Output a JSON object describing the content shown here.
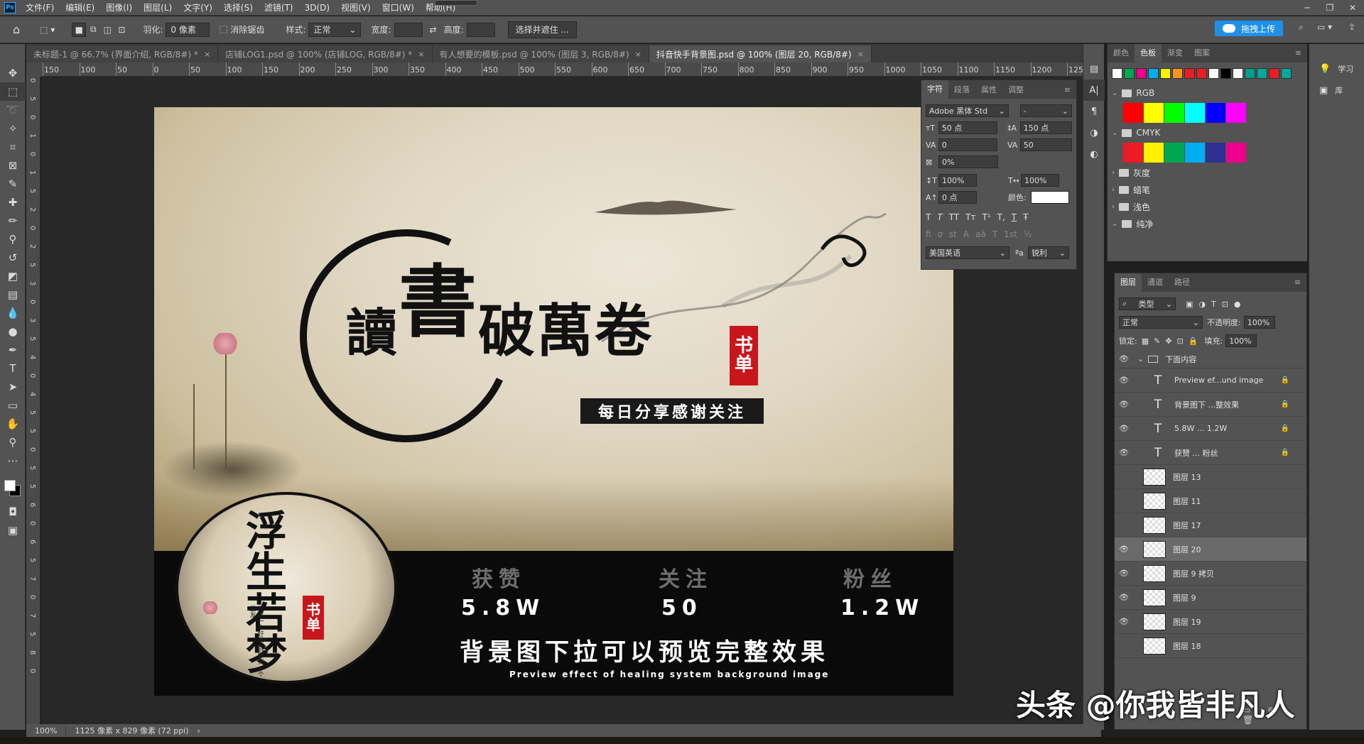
{
  "app": {
    "logo": "Ps",
    "menu": [
      "文件(F)",
      "编辑(E)",
      "图像(I)",
      "图层(L)",
      "文字(Y)",
      "选择(S)",
      "滤镜(T)",
      "3D(D)",
      "视图(V)",
      "窗口(W)",
      "帮助(H)"
    ]
  },
  "options": {
    "feather_label": "羽化:",
    "feather_value": "0 像素",
    "antialias_label": "消除锯齿",
    "style_label": "样式:",
    "style_value": "正常",
    "width_label": "宽度:",
    "height_label": "高度:",
    "select_mask_button": "选择并遮住 ...",
    "upload_button": "拖拽上传"
  },
  "tabs": [
    {
      "label": "未标题-1 @ 66.7% (界面介绍, RGB/8#) *",
      "close": "×"
    },
    {
      "label": "店铺LOG1.psd @ 100% (店铺LOG, RGB/8#) *",
      "close": "×"
    },
    {
      "label": "有人想要的模板.psd @ 100% (图层 3, RGB/8#)",
      "close": "×"
    },
    {
      "label": "抖音快手背景图.psd @ 100% (图层 20, RGB/8#)",
      "close": "×"
    }
  ],
  "ruler_h": [
    "150",
    "100",
    "50",
    "0",
    "50",
    "100",
    "150",
    "200",
    "250",
    "300",
    "350",
    "400",
    "450",
    "500",
    "550",
    "600",
    "650",
    "700",
    "750",
    "800",
    "850",
    "900",
    "950",
    "1000",
    "1050",
    "1100",
    "1150",
    "1200",
    "1250"
  ],
  "ruler_v": [
    "0",
    "5",
    "0",
    "1",
    "0",
    "1",
    "5",
    "2",
    "0",
    "2",
    "5",
    "3",
    "0",
    "3",
    "5",
    "4",
    "0",
    "4",
    "5",
    "5",
    "0",
    "5",
    "5",
    "6",
    "0",
    "6",
    "5",
    "7",
    "0",
    "7",
    "5",
    "8",
    "0"
  ],
  "design": {
    "title_chars": [
      "讀",
      "書",
      "破",
      "萬",
      "卷"
    ],
    "seal_main": [
      "书",
      "单"
    ],
    "subtitle": "每日分享感谢关注",
    "avatar_title": "浮生若梦",
    "avatar_seal": [
      "书",
      "单"
    ],
    "avatar_tiny_1": "读过一本好书",
    "avatar_tiny_2": "就像交一个益友",
    "stats": [
      {
        "label": "获赞",
        "value": "5.8W"
      },
      {
        "label": "关注",
        "value": "50"
      },
      {
        "label": "粉丝",
        "value": "1.2W"
      }
    ],
    "main_text": "背景图下拉可以预览完整效果",
    "sub_text": "Preview effect of healing system background image"
  },
  "character_panel": {
    "tabs": [
      "字符",
      "段落",
      "属性",
      "调整"
    ],
    "font_family": "Adobe 黑体 Std",
    "font_style": "-",
    "font_size": "50 点",
    "leading": "150 点",
    "kerning": "0",
    "tracking": "50",
    "scale_percent": "0%",
    "vscale": "100%",
    "hscale": "100%",
    "baseline": "0 点",
    "color_label": "颜色:",
    "styles": [
      "T",
      "T",
      "TT",
      "Tт",
      "T¹",
      "T,",
      "T",
      "Ŧ"
    ],
    "opentype": [
      "fi",
      "ơ",
      "st",
      "A",
      "aā",
      "T",
      "1st",
      "½"
    ],
    "language": "美国英语",
    "aa_label": "ªa",
    "antialias": "锐利"
  },
  "swatches": {
    "tabs": [
      "颜色",
      "色板",
      "渐变",
      "图案"
    ],
    "recent": [
      "#ffffff",
      "#00a651",
      "#ec008c",
      "#00aeef",
      "#fff200",
      "#f7941d",
      "#ed1c24",
      "#ee1c24",
      "#ffffff",
      "#000000",
      "#ffffff",
      "#009e8f",
      "#00a99d",
      "#ed1c24",
      "#00a99d"
    ],
    "groups": [
      {
        "name": "RGB",
        "open": true,
        "colors": [
          "#ff0000",
          "#ffff00",
          "#00ff00",
          "#00ffff",
          "#0000ff",
          "#ff00ff"
        ]
      },
      {
        "name": "CMYK",
        "open": true,
        "colors": [
          "#ed1c24",
          "#fff200",
          "#00a651",
          "#00aeef",
          "#2e3192",
          "#ec008c"
        ]
      },
      {
        "name": "灰度",
        "open": false
      },
      {
        "name": "蜡笔",
        "open": false
      },
      {
        "name": "浅色",
        "open": false
      },
      {
        "name": "纯净",
        "open": true
      }
    ]
  },
  "layers_panel": {
    "tabs": [
      "图层",
      "通道",
      "路径"
    ],
    "filter_kind": "类型",
    "blend_mode": "正常",
    "opacity_label": "不透明度:",
    "opacity": "100%",
    "lock_label": "锁定:",
    "fill_label": "填充:",
    "fill": "100%",
    "group_name": "下面内容",
    "layers": [
      {
        "type": "text",
        "name": "Preview ef...und image",
        "visible": true,
        "locked": true
      },
      {
        "type": "text",
        "name": "背景图下 ...整效果",
        "visible": true,
        "locked": true
      },
      {
        "type": "text",
        "name": "5.8W      ...     1.2W",
        "visible": true,
        "locked": true
      },
      {
        "type": "text",
        "name": "获赞      ...     粉丝",
        "visible": true,
        "locked": true
      },
      {
        "type": "image",
        "name": "图层 13",
        "visible": false,
        "locked": false
      },
      {
        "type": "image",
        "name": "图层 11",
        "visible": false,
        "locked": false
      },
      {
        "type": "image",
        "name": "图层 17",
        "visible": false,
        "locked": false
      },
      {
        "type": "image",
        "name": "图层 20",
        "visible": true,
        "locked": false,
        "selected": true
      },
      {
        "type": "image",
        "name": "图层 9 拷贝",
        "visible": true,
        "locked": false
      },
      {
        "type": "image",
        "name": "图层 9",
        "visible": true,
        "locked": false
      },
      {
        "type": "image",
        "name": "图层 19",
        "visible": true,
        "locked": false
      },
      {
        "type": "image",
        "name": "图层 18",
        "visible": false,
        "locked": false
      }
    ]
  },
  "far_right": [
    {
      "icon": "bulb-icon",
      "label": "学习"
    },
    {
      "icon": "library-icon",
      "label": "库"
    }
  ],
  "status": {
    "zoom": "100%",
    "info": "1125 像素 x 829 像素 (72 ppi)",
    "arrow": "›"
  },
  "watermark": "头条 @你我皆非凡人"
}
